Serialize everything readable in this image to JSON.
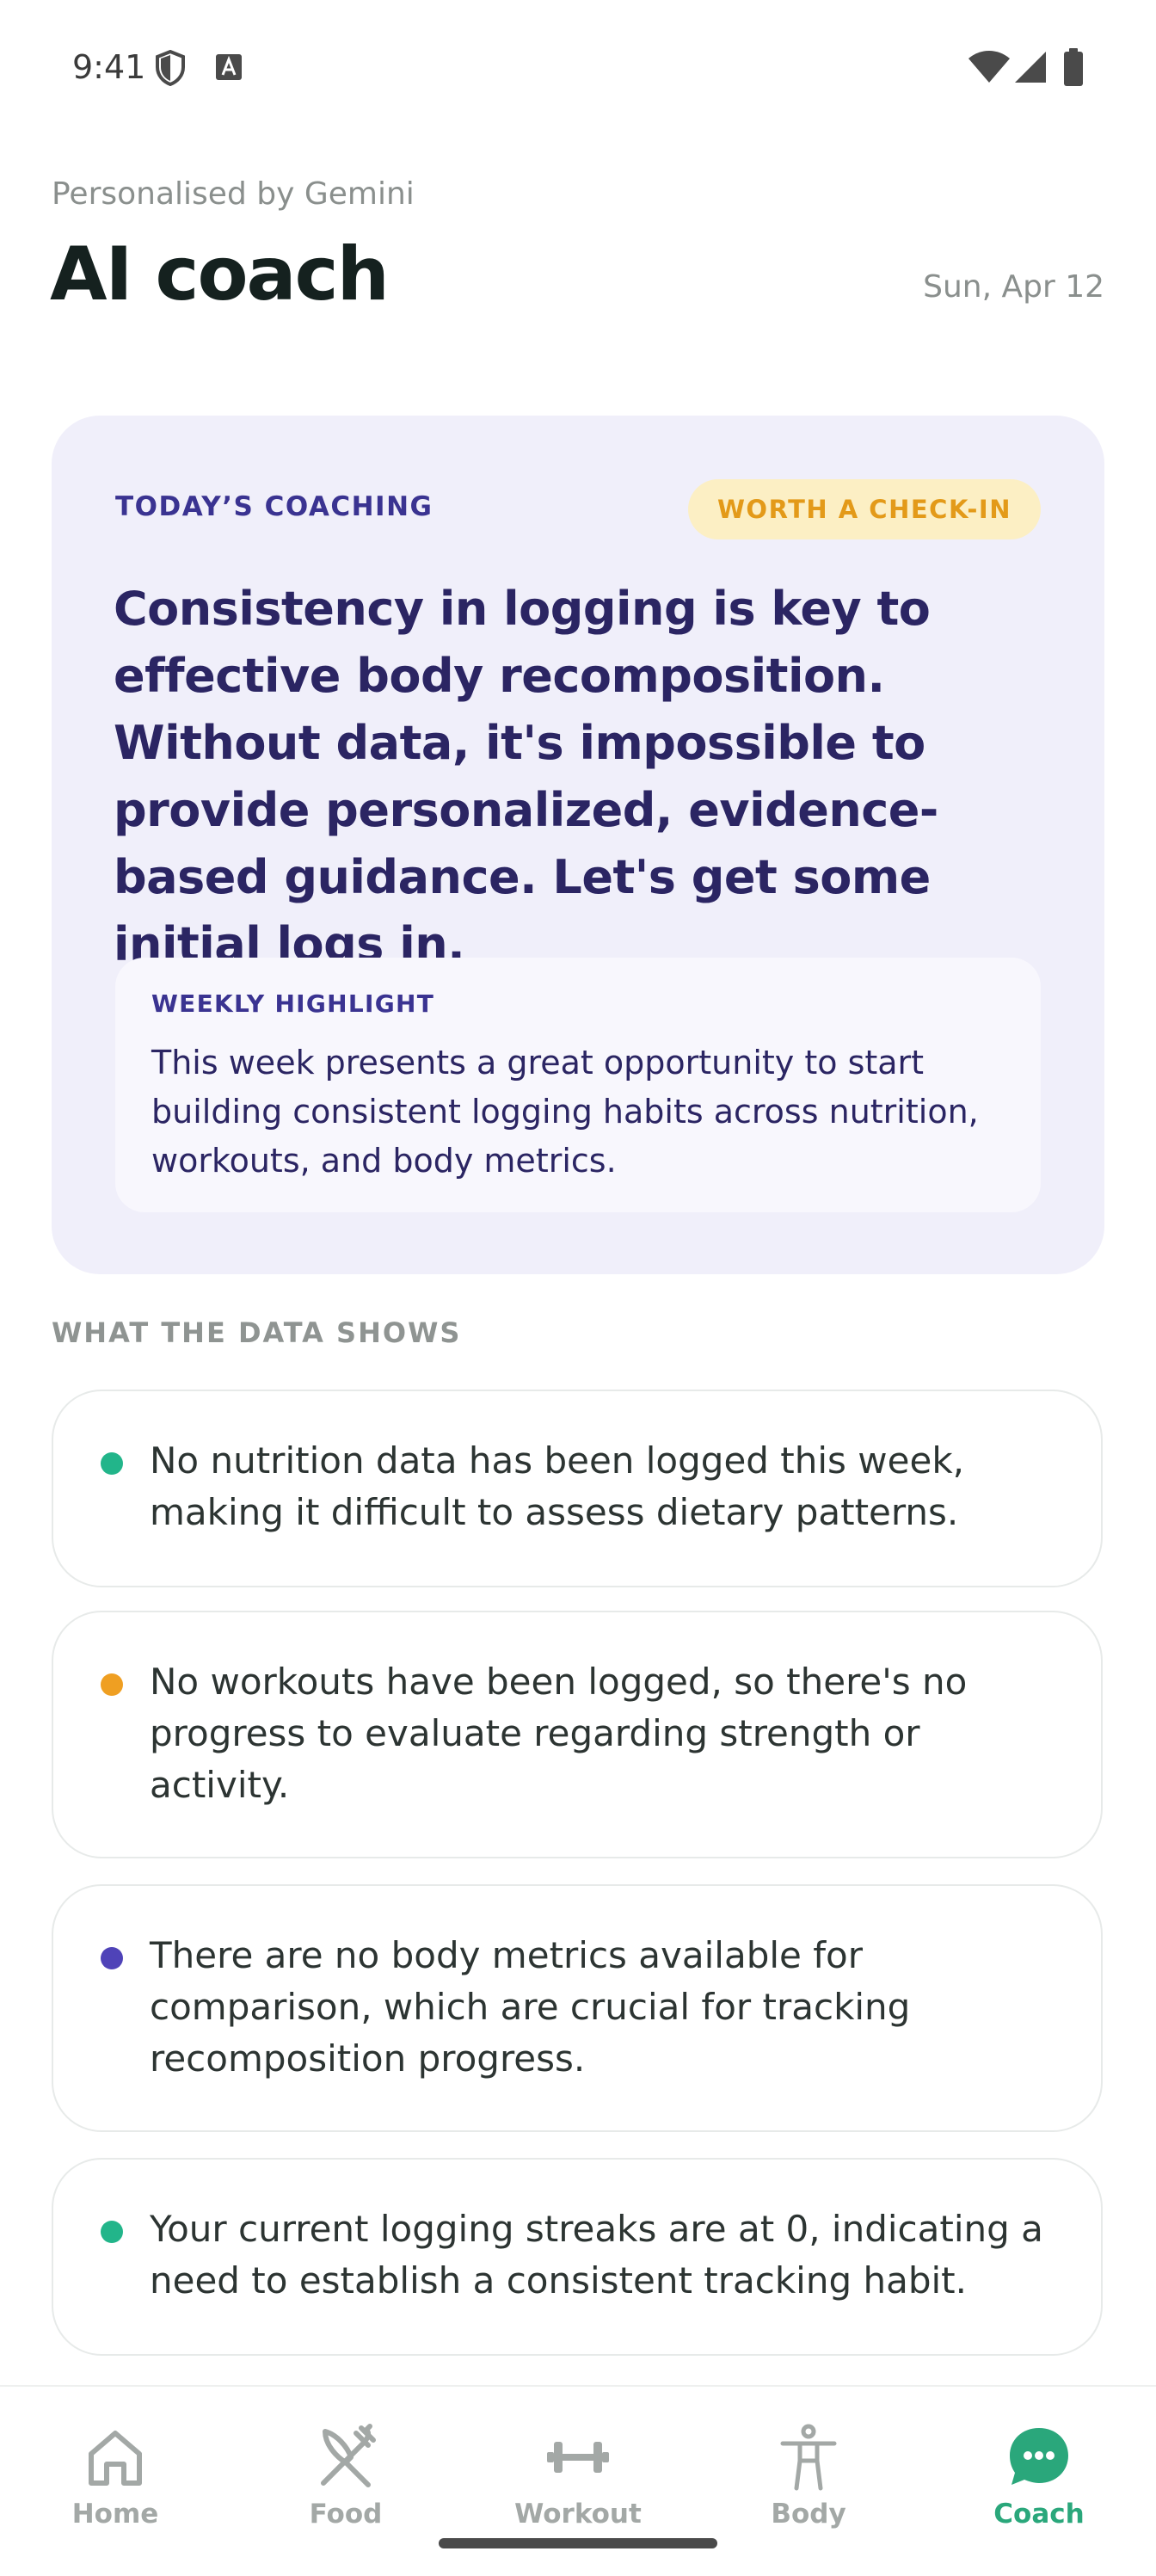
{
  "status_bar": {
    "time": "9:41"
  },
  "header": {
    "subtitle": "Personalised by Gemini",
    "title": "AI coach",
    "date": "Sun, Apr 12"
  },
  "coaching": {
    "eyebrow": "TODAY’S COACHING",
    "badge": "WORTH A CHECK-IN",
    "headline": "Consistency in logging is key to effective body recomposition. Without data, it's impossible to provide personalized, evidence-based guidance. Let's get some initial logs in.",
    "highlight": {
      "eyebrow": "WEEKLY HIGHLIGHT",
      "text": "This week presents a great opportunity to start building consistent logging habits across nutrition, workouts, and body metrics."
    }
  },
  "insights": {
    "section_label": "WHAT THE DATA SHOWS",
    "items": [
      {
        "text": "No nutrition data has been logged this week, making it difficult to assess dietary patterns.",
        "dot_color": "#22b58a"
      },
      {
        "text": "No workouts have been logged, so there's no progress to evaluate regarding strength or activity.",
        "dot_color": "#ef9f22"
      },
      {
        "text": "There are no body metrics available for comparison, which are crucial for tracking recomposition progress.",
        "dot_color": "#4f43b8"
      },
      {
        "text": "Your current logging streaks are at 0, indicating a need to establish a consistent tracking habit.",
        "dot_color": "#22b58a"
      }
    ]
  },
  "nav": {
    "items": [
      {
        "label": "Home",
        "icon": "home-icon"
      },
      {
        "label": "Food",
        "icon": "fork-knife-icon"
      },
      {
        "label": "Workout",
        "icon": "dumbbell-icon"
      },
      {
        "label": "Body",
        "icon": "person-icon"
      },
      {
        "label": "Coach",
        "icon": "chat-bubble-icon",
        "active": true
      }
    ]
  },
  "colors": {
    "accent": "#2aa77b",
    "coach_card_bg": "#f0effa",
    "badge_bg": "#fcefc4",
    "badge_text": "#e39a19",
    "indigo_text": "#2b2563"
  }
}
